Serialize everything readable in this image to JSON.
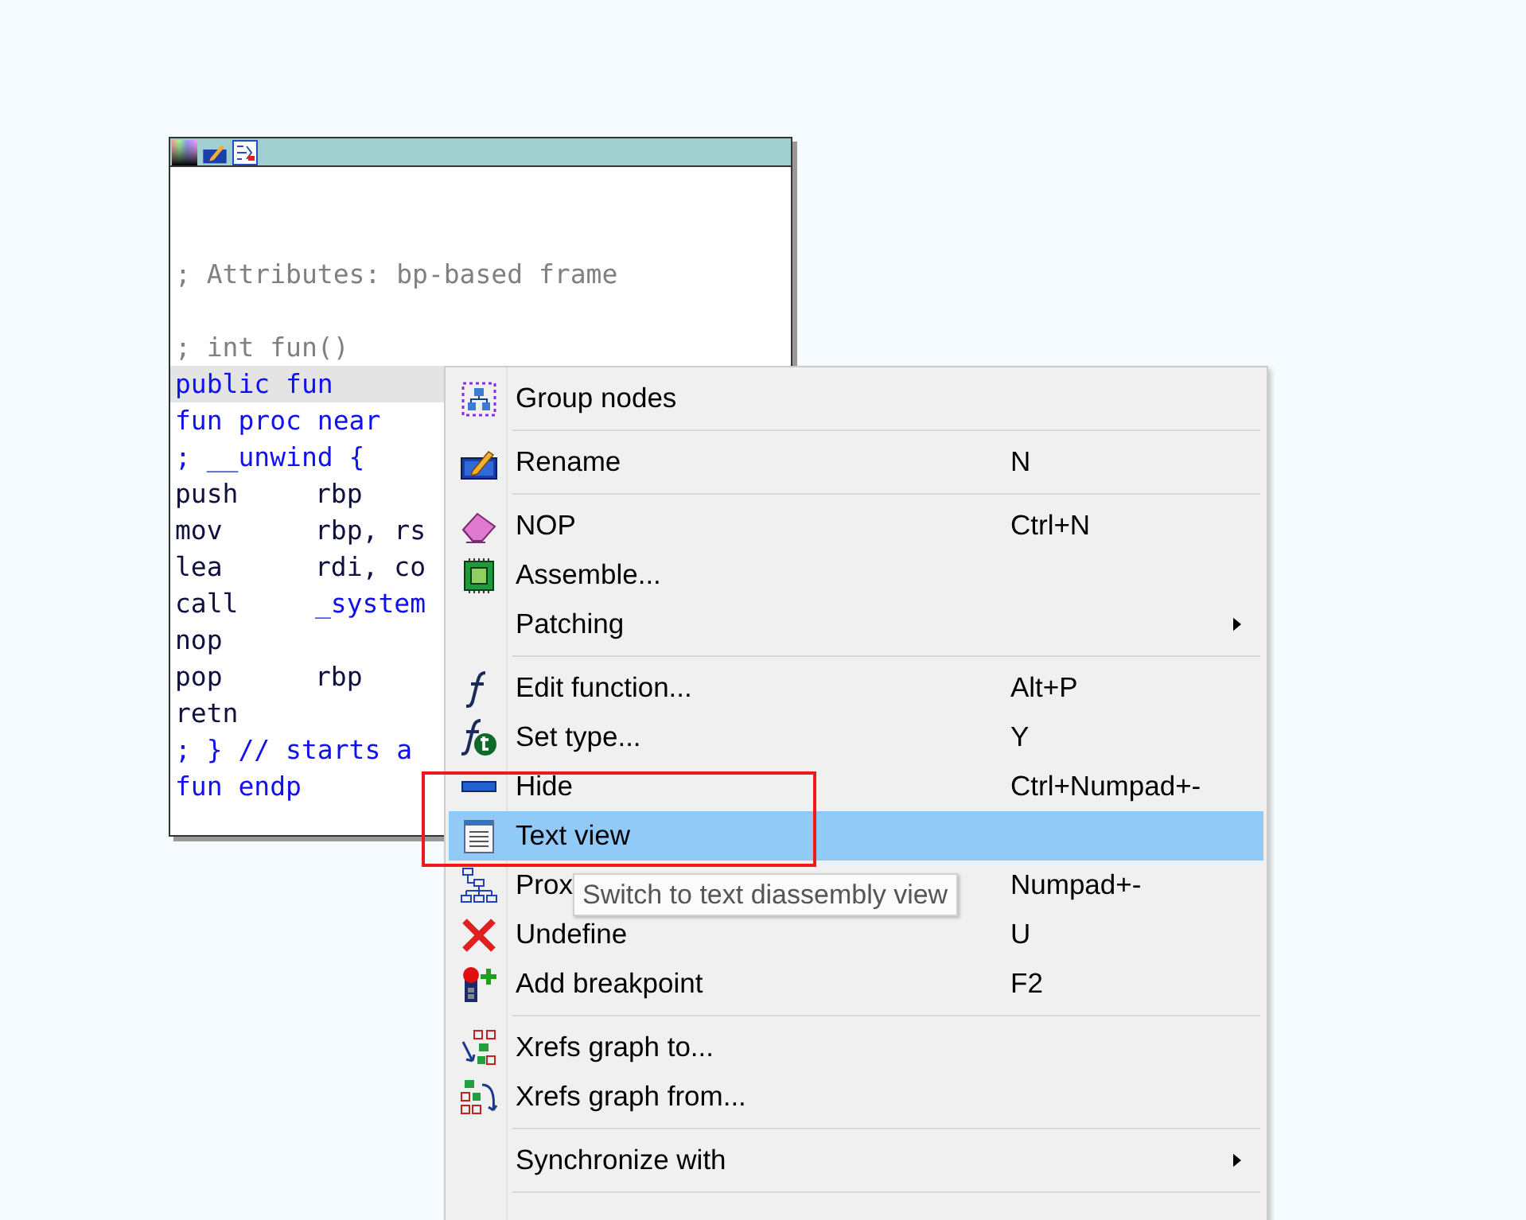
{
  "graph_node": {
    "lines": [
      {
        "kind": "blank"
      },
      {
        "kind": "blank"
      },
      {
        "kind": "comment",
        "text": "; Attributes: bp-based frame"
      },
      {
        "kind": "blank"
      },
      {
        "kind": "comment",
        "text": "; int fun()"
      },
      {
        "kind": "name",
        "text": "public fun",
        "selected": true
      },
      {
        "kind": "name",
        "text": "fun proc near",
        "selected": false
      },
      {
        "kind": "name",
        "text": "; __unwind {",
        "selected": false
      },
      {
        "kind": "insn",
        "mnemonic": "push",
        "operand": {
          "kind": "register",
          "text": "rbp"
        },
        "selected": false
      },
      {
        "kind": "insn",
        "mnemonic": "mov",
        "operand": {
          "kind": "register",
          "text": "rbp, rs"
        },
        "selected": false
      },
      {
        "kind": "insn",
        "mnemonic": "lea",
        "operand": {
          "kind": "register",
          "text": "rdi, co"
        },
        "selected": false
      },
      {
        "kind": "insn",
        "mnemonic": "call",
        "operand": {
          "kind": "name",
          "text": "_system"
        },
        "selected": false
      },
      {
        "kind": "insn",
        "mnemonic": "nop",
        "selected": false
      },
      {
        "kind": "insn",
        "mnemonic": "pop",
        "operand": {
          "kind": "register",
          "text": "rbp"
        },
        "selected": false
      },
      {
        "kind": "insn",
        "mnemonic": "retn",
        "selected": false
      },
      {
        "kind": "name",
        "text": "; } // starts a",
        "selected": false
      },
      {
        "kind": "name",
        "text": "fun endp",
        "selected": false
      }
    ]
  },
  "context_menu": {
    "items": [
      {
        "kind": "item",
        "label": "Group nodes",
        "selected": false
      },
      {
        "kind": "separator"
      },
      {
        "kind": "item",
        "label": "Rename",
        "shortcut": "N",
        "selected": false
      },
      {
        "kind": "separator"
      },
      {
        "kind": "item",
        "label": "NOP",
        "shortcut": "Ctrl+N",
        "selected": false
      },
      {
        "kind": "item",
        "label": "Assemble...",
        "selected": false
      },
      {
        "kind": "submenu",
        "label": "Patching",
        "selected": false
      },
      {
        "kind": "separator"
      },
      {
        "kind": "item",
        "label": "Edit function...",
        "shortcut": "Alt+P",
        "selected": false
      },
      {
        "kind": "item",
        "label": "Set type...",
        "shortcut": "Y",
        "selected": false
      },
      {
        "kind": "item",
        "label": "Hide",
        "shortcut": "Ctrl+Numpad+-",
        "selected": false
      },
      {
        "kind": "item",
        "label": "Text view",
        "selected": true
      },
      {
        "kind": "item",
        "label": "Prox",
        "shortcut": "Numpad+-",
        "selected": false
      },
      {
        "kind": "item",
        "label": "Undefine",
        "shortcut": "U",
        "selected": false
      },
      {
        "kind": "item",
        "label": "Add breakpoint",
        "shortcut": "F2",
        "selected": false
      },
      {
        "kind": "separator"
      },
      {
        "kind": "item",
        "label": "Xrefs graph to...",
        "selected": false
      },
      {
        "kind": "item",
        "label": "Xrefs graph from...",
        "selected": false
      },
      {
        "kind": "separator"
      },
      {
        "kind": "submenu",
        "label": "Synchronize with",
        "selected": false
      },
      {
        "kind": "separator"
      }
    ]
  },
  "tooltip": {
    "text": "Switch to text diassembly view"
  }
}
